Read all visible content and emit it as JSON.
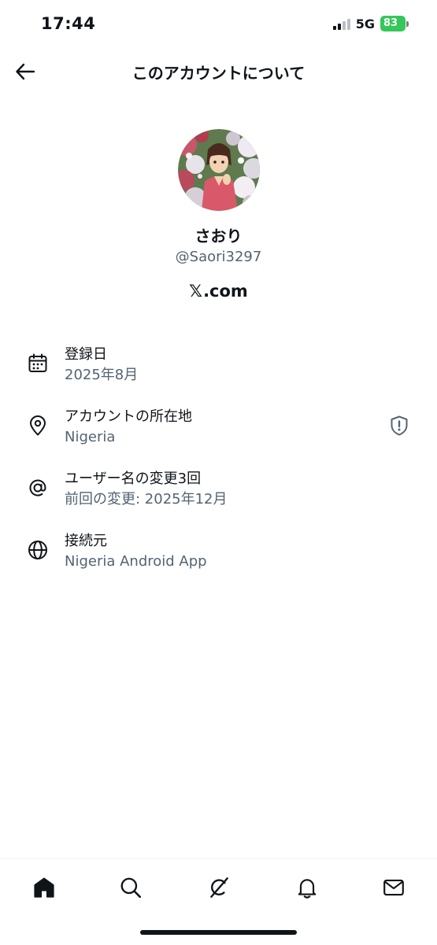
{
  "status_bar": {
    "time": "17:44",
    "network": "5G",
    "battery": "83"
  },
  "header": {
    "title": "このアカウントについて"
  },
  "profile": {
    "display_name": "さおり",
    "handle": "@Saori3297",
    "site_x": "𝕏",
    "site_rest": ".com"
  },
  "info": {
    "joined": {
      "label": "登録日",
      "value": "2025年8月",
      "icon": "calendar-icon"
    },
    "location": {
      "label": "アカウントの所在地",
      "value": "Nigeria",
      "icon": "location-pin-icon",
      "badge_icon": "shield-alert-icon"
    },
    "username_changes": {
      "label": "ユーザー名の変更3回",
      "value": "前回の変更: 2025年12月",
      "icon": "at-sign-icon"
    },
    "connected_via": {
      "label": "接続元",
      "value": "Nigeria Android App",
      "icon": "globe-icon"
    }
  },
  "tab_bar": {
    "tabs": [
      "home-icon",
      "search-icon",
      "grok-icon",
      "notifications-icon",
      "messages-icon"
    ]
  },
  "colors": {
    "text_primary": "#0f1419",
    "text_secondary": "#536471",
    "battery_green": "#34c759"
  }
}
